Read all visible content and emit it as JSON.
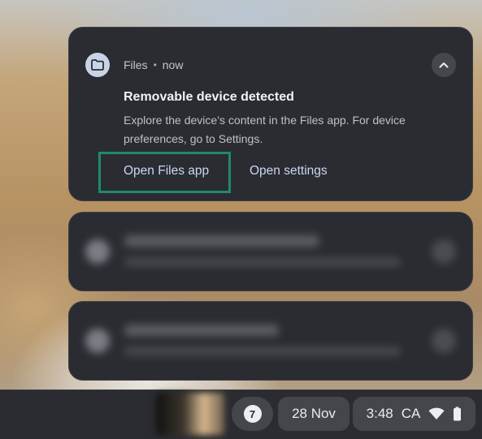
{
  "notification": {
    "app_name": "Files",
    "separator": "•",
    "time": "now",
    "title": "Removable device detected",
    "body": "Explore the device’s content in the Files app. For device preferences, go to Settings.",
    "actions": [
      {
        "label": "Open Files app"
      },
      {
        "label": "Open settings"
      }
    ],
    "icon": "folder-icon",
    "collapse_icon": "chevron-up-icon"
  },
  "shelf": {
    "notification_count": "7",
    "date": "28 Nov",
    "time": "3:48",
    "locale": "CA",
    "icons": [
      "wifi-icon",
      "battery-icon"
    ]
  },
  "colors": {
    "card_bg": "#2b2c31",
    "focus_ring": "#1f8a70",
    "action_text": "#c8d8f5"
  }
}
